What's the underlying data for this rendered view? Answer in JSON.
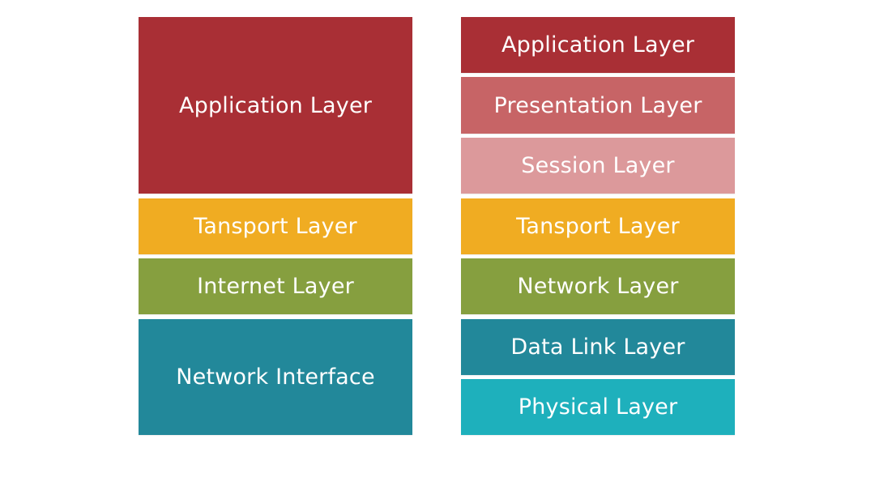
{
  "tcpip_model": {
    "layers": [
      {
        "label": "Application Layer",
        "color": "#a92f35"
      },
      {
        "label": "Tansport Layer",
        "color": "#f0ac22"
      },
      {
        "label": "Internet Layer",
        "color": "#869f3f"
      },
      {
        "label": "Network Interface",
        "color": "#22889a"
      }
    ]
  },
  "osi_model": {
    "layers": [
      {
        "label": "Application Layer",
        "color": "#a92f35"
      },
      {
        "label": "Presentation Layer",
        "color": "#c76466"
      },
      {
        "label": "Session Layer",
        "color": "#dc999b"
      },
      {
        "label": "Tansport Layer",
        "color": "#f0ac22"
      },
      {
        "label": "Network Layer",
        "color": "#869f3f"
      },
      {
        "label": "Data Link Layer",
        "color": "#22889a"
      },
      {
        "label": "Physical Layer",
        "color": "#1eb0bc"
      }
    ]
  }
}
